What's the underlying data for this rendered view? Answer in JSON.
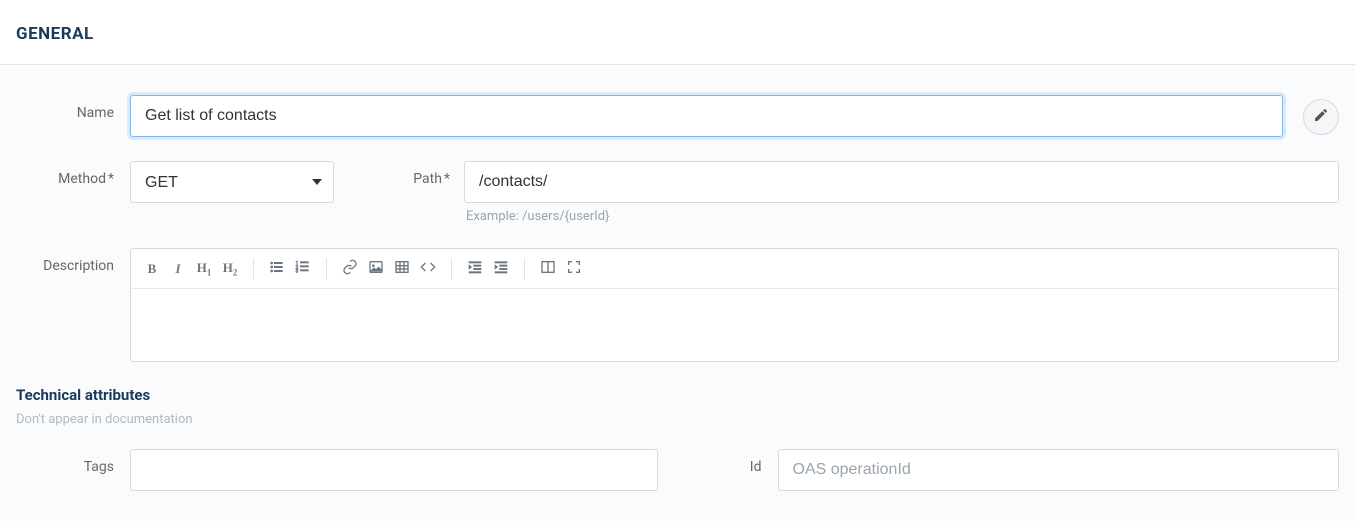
{
  "header": {
    "title": "GENERAL"
  },
  "form": {
    "name_label": "Name",
    "name_value": "Get list of contacts",
    "method_label": "Method",
    "method_value": "GET",
    "path_label": "Path",
    "path_value": "/contacts/",
    "path_hint": "Example: /users/{userId}",
    "description_label": "Description",
    "description_value": ""
  },
  "technical": {
    "title": "Technical attributes",
    "subtitle": "Don't appear in documentation",
    "tags_label": "Tags",
    "tags_value": "",
    "id_label": "Id",
    "id_placeholder": "OAS operationId",
    "id_value": ""
  }
}
